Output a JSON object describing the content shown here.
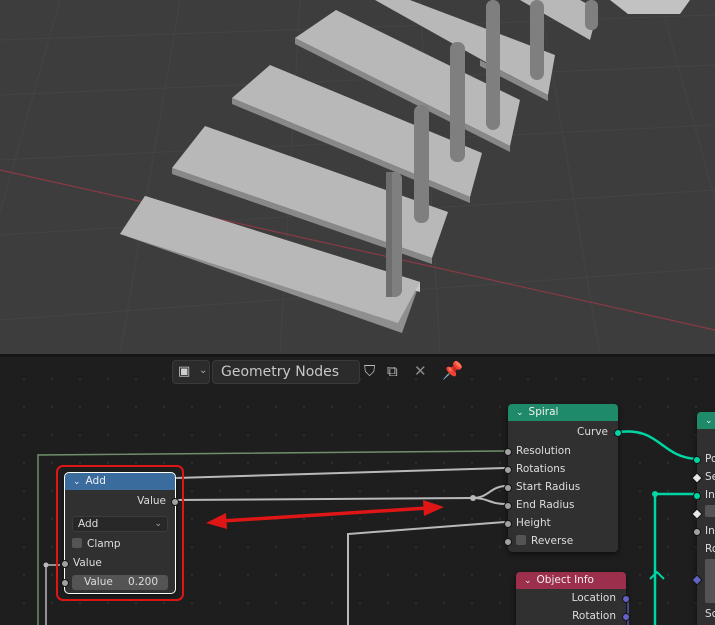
{
  "header": {
    "node_tree_name": "Geometry Nodes",
    "icons": [
      "editor-type-icon",
      "fake-user-shield-icon",
      "duplicate-icon",
      "close-icon",
      "pin-icon"
    ]
  },
  "nodes": {
    "add": {
      "title": "Add",
      "output_label": "Value",
      "operation": "Add",
      "clamp_label": "Clamp",
      "input_label": "Value",
      "value_field_label": "Value",
      "value_field_value": "0.200"
    },
    "spiral": {
      "title": "Spiral",
      "output_label": "Curve",
      "inputs": [
        "Resolution",
        "Rotations",
        "Start Radius",
        "End Radius",
        "Height"
      ],
      "reverse_label": "Reverse"
    },
    "object_info": {
      "title": "Object Info",
      "outputs": [
        "Location",
        "Rotation"
      ]
    },
    "cut_off_node": {
      "rows": [
        "Po",
        "Se",
        "Ins",
        "",
        "Ins",
        "Ro",
        "",
        "",
        "Sc"
      ]
    }
  },
  "colors": {
    "geometry_wire": "#00d6a3",
    "float_wire": "#a1a1a1",
    "annotation_red": "#e01515",
    "math_header": "#3b6c9e",
    "geometry_header": "#1e8a6a",
    "input_header": "#9b2f4c"
  }
}
